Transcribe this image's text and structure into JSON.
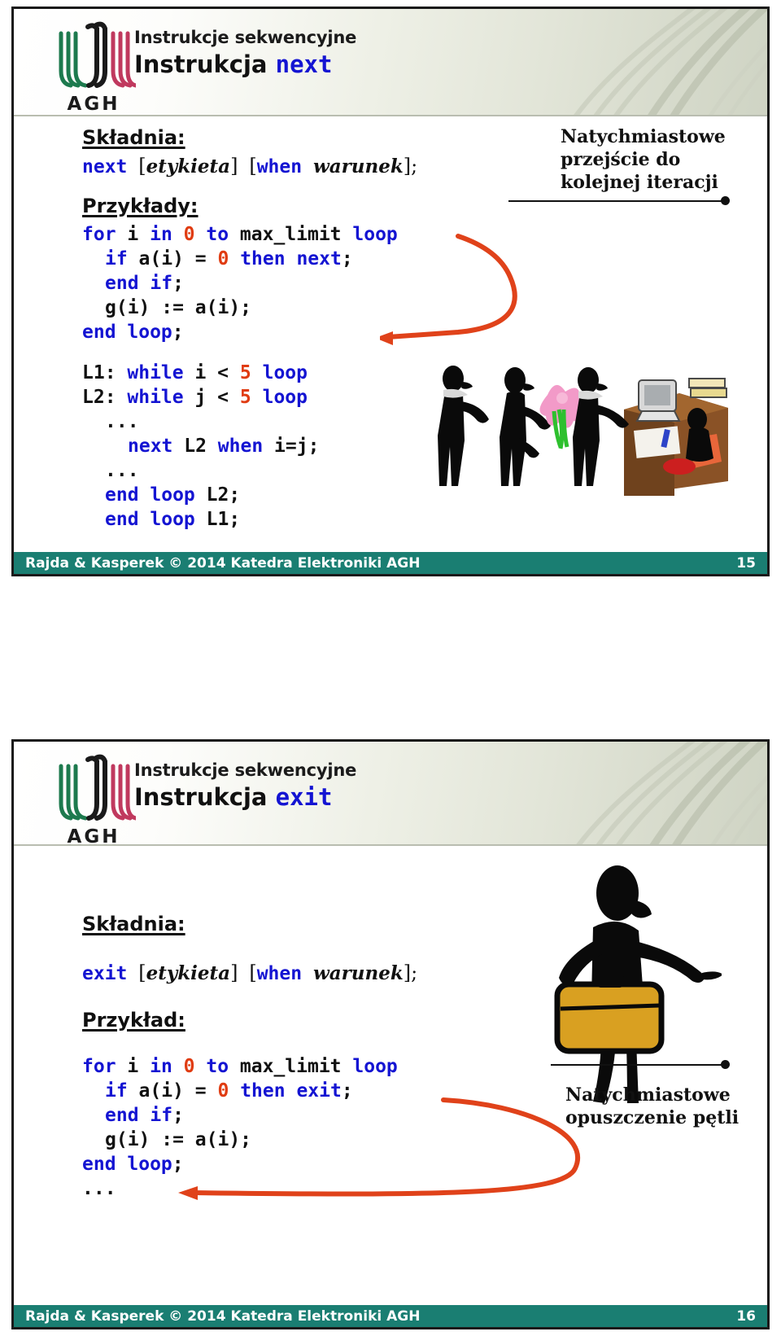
{
  "document": {
    "kind": "lecture-slides",
    "slide_count": 2
  },
  "slide_next": {
    "logo_text": "AGH",
    "header": {
      "subtitle": "Instrukcje sekwencyjne",
      "title_static": "Instrukcja",
      "title_keyword": "next"
    },
    "syntax_heading": "Składnia:",
    "syntax": {
      "keyword": "next",
      "open1": "[",
      "label": "etykieta",
      "close1": "]",
      "open2": "[",
      "when": "when",
      "cond": "warunek",
      "close2": "];"
    },
    "examples_heading": "Przykłady:",
    "code_block_1": [
      {
        "indent": 0,
        "tokens": [
          {
            "t": "for ",
            "c": "kw"
          },
          {
            "t": "i ",
            "c": "id"
          },
          {
            "t": "in ",
            "c": "kw"
          },
          {
            "t": "0",
            "c": "num"
          },
          {
            "t": " ",
            "c": "id"
          },
          {
            "t": "to ",
            "c": "kw"
          },
          {
            "t": "max_limit ",
            "c": "id"
          },
          {
            "t": "loop",
            "c": "kw"
          }
        ]
      },
      {
        "indent": 1,
        "tokens": [
          {
            "t": "if ",
            "c": "kw"
          },
          {
            "t": "a(i) = ",
            "c": "id"
          },
          {
            "t": "0",
            "c": "num"
          },
          {
            "t": " ",
            "c": "id"
          },
          {
            "t": "then next",
            "c": "kw"
          },
          {
            "t": ";",
            "c": "id"
          }
        ]
      },
      {
        "indent": 1,
        "tokens": [
          {
            "t": "end if",
            "c": "kw"
          },
          {
            "t": ";",
            "c": "id"
          }
        ]
      },
      {
        "indent": 1,
        "tokens": [
          {
            "t": "g(i) := a(i);",
            "c": "id"
          }
        ]
      },
      {
        "indent": 0,
        "tokens": [
          {
            "t": "end loop",
            "c": "kw"
          },
          {
            "t": ";",
            "c": "id"
          }
        ]
      }
    ],
    "code_block_2": [
      {
        "indent": 0,
        "tokens": [
          {
            "t": "L1: ",
            "c": "id"
          },
          {
            "t": "while ",
            "c": "kw"
          },
          {
            "t": "i < ",
            "c": "id"
          },
          {
            "t": "5",
            "c": "num"
          },
          {
            "t": " ",
            "c": "id"
          },
          {
            "t": "loop",
            "c": "kw"
          }
        ]
      },
      {
        "indent": 0,
        "tokens": [
          {
            "t": "L2: ",
            "c": "id"
          },
          {
            "t": "while ",
            "c": "kw"
          },
          {
            "t": "j < ",
            "c": "id"
          },
          {
            "t": "5",
            "c": "num"
          },
          {
            "t": " ",
            "c": "id"
          },
          {
            "t": "loop",
            "c": "kw"
          }
        ]
      },
      {
        "indent": 1,
        "tokens": [
          {
            "t": "...",
            "c": "id"
          }
        ]
      },
      {
        "indent": 2,
        "tokens": [
          {
            "t": "next ",
            "c": "kw"
          },
          {
            "t": "L2 ",
            "c": "id"
          },
          {
            "t": "when ",
            "c": "kw"
          },
          {
            "t": "i=j;",
            "c": "id"
          }
        ]
      },
      {
        "indent": 1,
        "tokens": [
          {
            "t": "...",
            "c": "id"
          }
        ]
      },
      {
        "indent": 1,
        "tokens": [
          {
            "t": "end loop ",
            "c": "kw"
          },
          {
            "t": "L2;",
            "c": "id"
          }
        ]
      },
      {
        "indent": 1,
        "tokens": [
          {
            "t": "end loop ",
            "c": "kw"
          },
          {
            "t": "L1;",
            "c": "id"
          }
        ]
      }
    ],
    "annotation": "Natychmiastowe przejście do kolejnej iteracji",
    "annotation_lines": [
      "Natychmiastowe",
      "przejście do",
      "kolejnej iteracji"
    ],
    "artwork_name": "queue-of-people-at-desk-clipart",
    "footer": {
      "text": "Rajda & Kasperek © 2014 Katedra Elektroniki AGH",
      "page": "15"
    }
  },
  "slide_exit": {
    "logo_text": "AGH",
    "header": {
      "subtitle": "Instrukcje sekwencyjne",
      "title_static": "Instrukcja",
      "title_keyword": "exit"
    },
    "syntax_heading": "Składnia:",
    "syntax": {
      "keyword": "exit",
      "open1": "[",
      "label": "etykieta",
      "close1": "]",
      "open2": "[",
      "when": "when",
      "cond": "warunek",
      "close2": "];"
    },
    "examples_heading": "Przykład:",
    "code_block_1": [
      {
        "indent": 0,
        "tokens": [
          {
            "t": "for ",
            "c": "kw"
          },
          {
            "t": "i ",
            "c": "id"
          },
          {
            "t": "in ",
            "c": "kw"
          },
          {
            "t": "0",
            "c": "num"
          },
          {
            "t": " ",
            "c": "id"
          },
          {
            "t": "to ",
            "c": "kw"
          },
          {
            "t": "max_limit ",
            "c": "id"
          },
          {
            "t": "loop",
            "c": "kw"
          }
        ]
      },
      {
        "indent": 1,
        "tokens": [
          {
            "t": "if ",
            "c": "kw"
          },
          {
            "t": "a(i) = ",
            "c": "id"
          },
          {
            "t": "0",
            "c": "num"
          },
          {
            "t": " ",
            "c": "id"
          },
          {
            "t": "then exit",
            "c": "kw"
          },
          {
            "t": ";",
            "c": "id"
          }
        ]
      },
      {
        "indent": 1,
        "tokens": [
          {
            "t": "end if",
            "c": "kw"
          },
          {
            "t": ";",
            "c": "id"
          }
        ]
      },
      {
        "indent": 1,
        "tokens": [
          {
            "t": "g(i) := a(i);",
            "c": "id"
          }
        ]
      },
      {
        "indent": 0,
        "tokens": [
          {
            "t": "end loop",
            "c": "kw"
          },
          {
            "t": ";",
            "c": "id"
          }
        ]
      },
      {
        "indent": 0,
        "tokens": [
          {
            "t": "...",
            "c": "id"
          }
        ]
      }
    ],
    "annotation": "Natychmiastowe opuszczenie pętli",
    "annotation_lines": [
      "Natychmiastowe",
      "opuszczenie pętli"
    ],
    "artwork_name": "woman-with-suitcase-clipart",
    "footer": {
      "text": "Rajda & Kasperek © 2014 Katedra Elektroniki AGH",
      "page": "16"
    }
  },
  "colors": {
    "keyword_blue": "#1414d2",
    "number_red": "#e03c12",
    "arrow_orange": "#e0421a",
    "footer_teal": "#1a7e72",
    "logo_green": "#1d7a4e",
    "logo_black": "#1a1a1a",
    "logo_crimson": "#c0395e",
    "suitcase_gold": "#d9a021",
    "desk_brown": "#8a5226",
    "flower_pink": "#f29ac8"
  }
}
